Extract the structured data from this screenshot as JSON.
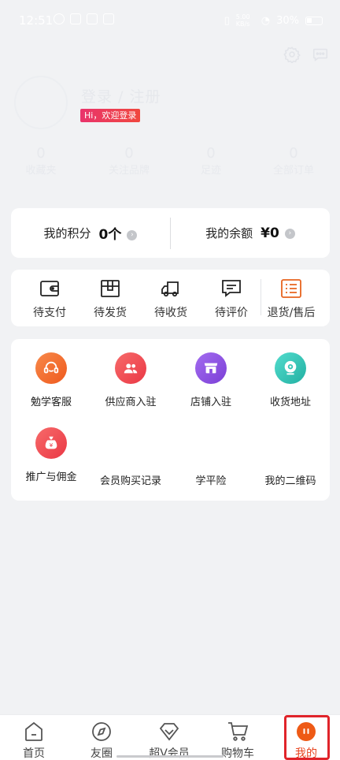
{
  "status_bar": {
    "time": "12:51",
    "network_label": "5.00 KB/s",
    "battery": "30%"
  },
  "profile": {
    "login_title": "登录 / 注册",
    "welcome_badge": "Hi，欢迎登录"
  },
  "stats": [
    {
      "count": "0",
      "label": "收藏夹"
    },
    {
      "count": "0",
      "label": "关注品牌"
    },
    {
      "count": "0",
      "label": "足迹"
    },
    {
      "count": "0",
      "label": "全部订单"
    }
  ],
  "points": {
    "points_label": "我的积分",
    "points_value": "0个",
    "balance_label": "我的余额",
    "balance_value": "¥0"
  },
  "orders": [
    {
      "label": "待支付",
      "icon": "wallet-icon"
    },
    {
      "label": "待发货",
      "icon": "box-icon"
    },
    {
      "label": "待收货",
      "icon": "truck-icon"
    },
    {
      "label": "待评价",
      "icon": "comment-icon"
    },
    {
      "label": "退货/售后",
      "icon": "list-icon"
    }
  ],
  "services": [
    {
      "label": "勉学客服",
      "icon": "headset-icon",
      "color": "#f26b2e"
    },
    {
      "label": "供应商入驻",
      "icon": "users-icon",
      "color": "#ef4a55"
    },
    {
      "label": "店铺入驻",
      "icon": "shop-icon",
      "color": "#8a4ee0"
    },
    {
      "label": "收货地址",
      "icon": "location-icon",
      "color": "#35c4b6"
    },
    {
      "label": "推广与佣金",
      "icon": "money-bag-icon",
      "color": "#ef4a55"
    },
    {
      "label": "会员购买记录"
    },
    {
      "label": "学平险"
    },
    {
      "label": "我的二维码"
    }
  ],
  "nav": [
    {
      "label": "首页",
      "icon": "home-icon"
    },
    {
      "label": "友圈",
      "icon": "compass-icon"
    },
    {
      "label": "超V会员",
      "icon": "diamond-icon"
    },
    {
      "label": "购物车",
      "icon": "cart-icon"
    },
    {
      "label": "我的",
      "icon": "profile-icon",
      "active": true
    }
  ],
  "colors": {
    "accent": "#e8441f",
    "highlight_frame": "#e0242a"
  }
}
